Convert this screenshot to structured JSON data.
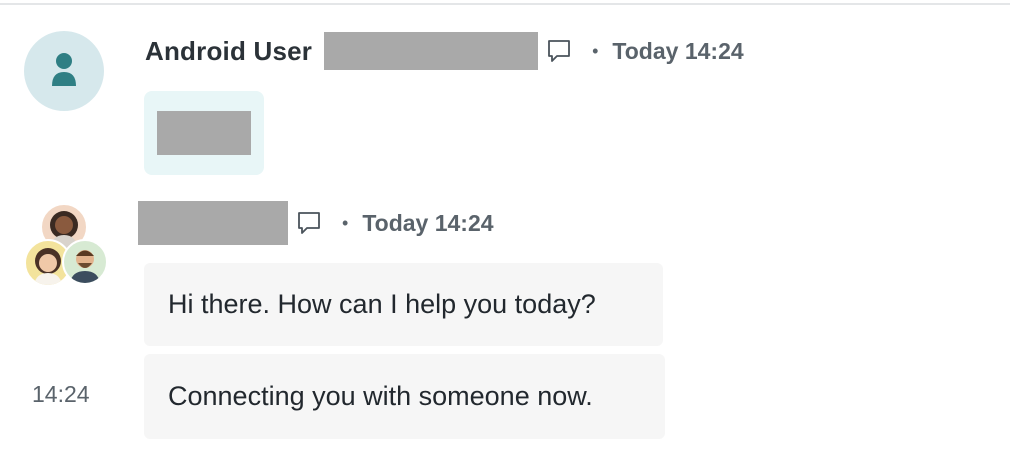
{
  "messages": [
    {
      "sender": "Android User",
      "timestamp": "Today 14:24",
      "avatar_icon": "user-icon",
      "action_icon": "comment-icon",
      "separator": "•",
      "attachment": "redacted"
    },
    {
      "sender": "",
      "timestamp": "Today 14:24",
      "avatar_icon": "team-avatars",
      "action_icon": "comment-icon",
      "separator": "•",
      "bubbles": [
        {
          "text": "Hi there. How can I help you today?"
        },
        {
          "text": "Connecting you with someone now.",
          "side_time": "14:24"
        }
      ]
    }
  ],
  "colors": {
    "avatar_bg": "#d6e8ec",
    "avatar_icon": "#2f7f84",
    "attachment_bg": "#e8f6f7",
    "bubble_bg": "#f6f6f6",
    "redaction": "#a9a9a9",
    "muted_text": "#5a636b"
  }
}
